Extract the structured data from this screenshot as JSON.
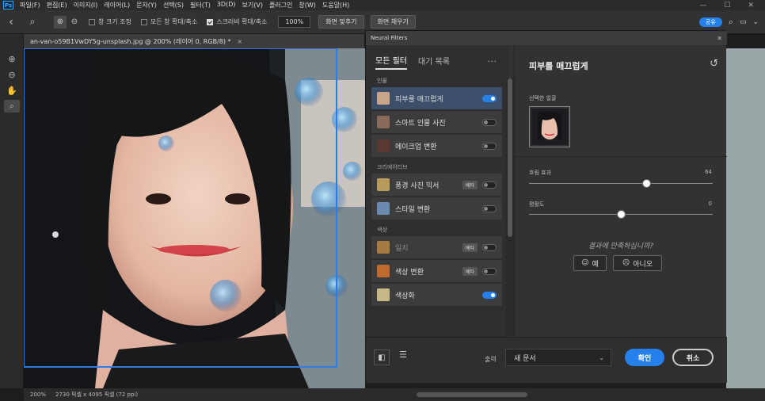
{
  "app": {
    "logo": "Ps"
  },
  "menubar": {
    "items": [
      "파일(F)",
      "편집(E)",
      "이미지(I)",
      "레이어(L)",
      "문자(Y)",
      "선택(S)",
      "필터(T)",
      "3D(D)",
      "보기(V)",
      "플러그인",
      "창(W)",
      "도움말(H)"
    ]
  },
  "options": {
    "resize_window": "창 크기 조정",
    "zoom_all": "모든 창 확대/축소",
    "scrubby_zoom": "스크러비 확대/축소",
    "zoom_value": "100%",
    "fit_screen": "화면 맞추기",
    "fill_screen": "화면 채우기",
    "share": "공유"
  },
  "document": {
    "tab_title": "an-van-o59B1VwDY5g-unsplash.jpg @ 200% (레이어 0, RGB/8) *",
    "close": "×"
  },
  "status": {
    "zoom": "200%",
    "dimensions": "2730 픽셀 x 4095 픽셀 (72 ppi)"
  },
  "neural_filters": {
    "title": "Neural Filters",
    "tabs": {
      "all": "모든 필터",
      "waitlist": "대기 목록"
    },
    "categories": [
      {
        "name": "인물",
        "filters": [
          {
            "label": "피부를 매끄럽게",
            "on": true,
            "selected": true,
            "beta": null,
            "thumb": "#c9a58a"
          },
          {
            "label": "스마트 인물 사진",
            "on": false,
            "beta": null,
            "thumb": "#8a6a58"
          },
          {
            "label": "메이크업 변환",
            "on": false,
            "beta": null,
            "thumb": "#5a3a30"
          }
        ]
      },
      {
        "name": "크리에이티브",
        "filters": [
          {
            "label": "풍경 사진 믹서",
            "on": false,
            "beta": "베타",
            "thumb": "#b89a5a"
          },
          {
            "label": "스타일 변환",
            "on": false,
            "beta": null,
            "thumb": "#6a8ab0"
          }
        ]
      },
      {
        "name": "색상",
        "filters": [
          {
            "label": "일치",
            "on": false,
            "beta": "베타",
            "thumb": "#a67a40",
            "dim": true
          },
          {
            "label": "색상 변환",
            "on": false,
            "beta": "베타",
            "thumb": "#c06a30"
          },
          {
            "label": "색상화",
            "on": true,
            "beta": null,
            "thumb": "#c8b888"
          }
        ]
      }
    ],
    "panel": {
      "title": "피부를 매끄럽게",
      "selected_face": "선택한 얼굴",
      "blur_label": "흐림 효과",
      "blur_value": "64",
      "blur_level": 0.64,
      "smooth_label": "평활도",
      "smooth_value": "0",
      "smooth_level": 0.5,
      "feedback": "결과에 만족하십니까?",
      "yes": "예",
      "no": "아니오"
    },
    "footer": {
      "output_label": "출력",
      "output_value": "새 문서",
      "ok": "확인",
      "cancel": "취소"
    }
  },
  "colors": {
    "accent": "#2680eb",
    "selection": "#3b4e6a"
  }
}
